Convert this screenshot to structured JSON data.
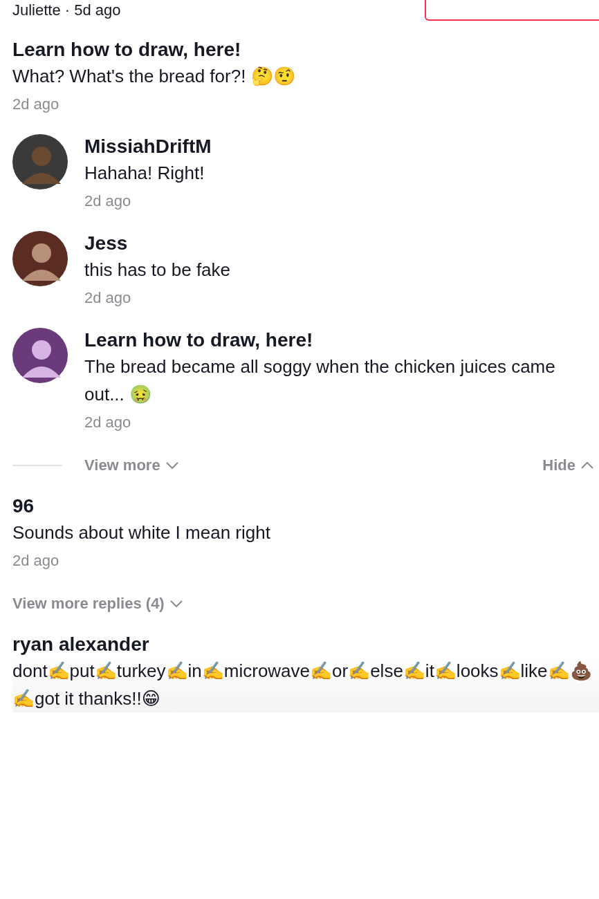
{
  "top_fragment": {
    "byline": "Juliette · 5d ago"
  },
  "comments": [
    {
      "author": "Learn how to draw, here!",
      "text": "What? What's the bread for?! 🤔🤨",
      "time": "2d ago",
      "replies": [
        {
          "author": "MissiahDriftM",
          "text": "Hahaha! Right!",
          "time": "2d ago"
        },
        {
          "author": "Jess",
          "text": "this has to be fake",
          "time": "2d ago"
        },
        {
          "author": "Learn how to draw, here!",
          "text": "The bread became all soggy when the chicken juices came out... 🤢",
          "time": "2d ago"
        }
      ],
      "view_more": "View more",
      "hide": "Hide"
    },
    {
      "author": "96",
      "text": "Sounds about white I mean right",
      "time": "2d ago",
      "view_replies": "View more replies (4)"
    },
    {
      "author": "ryan alexander",
      "text": "dont✍️put✍️turkey✍️in✍️microwave✍️or✍️else✍️it✍️looks✍️like✍️💩✍️got it thanks!!😁"
    }
  ]
}
